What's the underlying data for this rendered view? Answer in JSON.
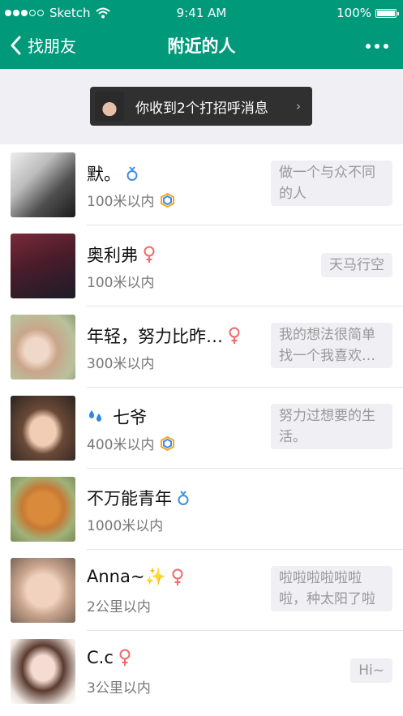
{
  "status_bar": {
    "carrier": "Sketch",
    "time": "9:41 AM",
    "battery": "100%"
  },
  "nav": {
    "back_label": "找朋友",
    "title": "附近的人"
  },
  "greeting": {
    "text": "你收到2个打招呼消息",
    "chevron": "›"
  },
  "people": [
    {
      "name": "默。",
      "gender": "male",
      "distance": "100米以内",
      "badge": true,
      "status": "做一个与众不同的人"
    },
    {
      "name": "奥利弗",
      "gender": "female",
      "distance": "100米以内",
      "badge": false,
      "status": "天马行空"
    },
    {
      "name": "年轻，努力比昨…",
      "gender": "female",
      "distance": "300米以内",
      "badge": false,
      "status": "我的想法很简单找一个我喜欢…"
    },
    {
      "name": "七爷",
      "gender": "none",
      "name_icon": "droplets",
      "distance": "400米以内",
      "badge": true,
      "status": "努力过想要的生活。"
    },
    {
      "name": "不万能青年",
      "gender": "male",
      "distance": "1000米以内",
      "badge": false,
      "status": ""
    },
    {
      "name": "Anna~✨",
      "gender": "female",
      "distance": "2公里以内",
      "badge": false,
      "status": "啦啦啦啦啦啦啦，种太阳了啦"
    },
    {
      "name": "C.c",
      "gender": "female",
      "distance": "3公里以内",
      "badge": false,
      "status": "Hi~"
    }
  ],
  "colors": {
    "header": "#009a7b",
    "male": "#3f8fe0",
    "female": "#f06a6a"
  },
  "icons": {
    "back": "chevron-left-icon",
    "more": "more-icon",
    "male": "male-symbol-icon",
    "female": "female-symbol-icon",
    "badge": "hexagon-badge-icon",
    "name_icon": "water-drops-icon"
  }
}
